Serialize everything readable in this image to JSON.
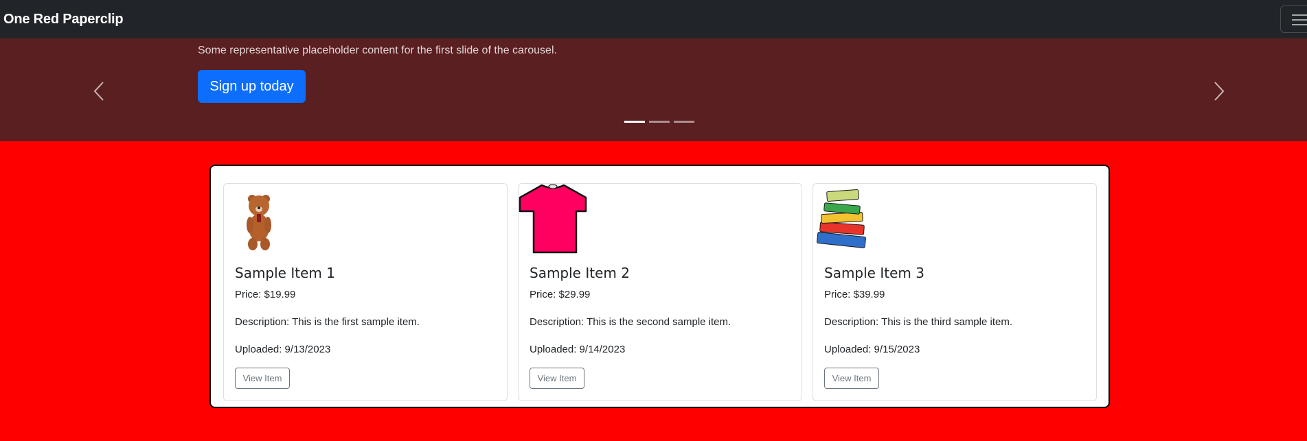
{
  "navbar": {
    "brand": "One Red Paperclip",
    "menu_icon": "hamburger-menu-icon"
  },
  "carousel": {
    "caption": "Some representative placeholder content for the first slide of the carousel.",
    "cta_label": "Sign up today",
    "prev_icon": "chevron-left-icon",
    "next_icon": "chevron-right-icon",
    "slide_count": 3,
    "active_slide": 1
  },
  "items": [
    {
      "title": "Sample Item 1",
      "price": "Price: $19.99",
      "description": "Description: This is the first sample item.",
      "uploaded": "Uploaded: 9/13/2023",
      "button": "View Item",
      "image": "teddy-bear-image"
    },
    {
      "title": "Sample Item 2",
      "price": "Price: $29.99",
      "description": "Description: This is the second sample item.",
      "uploaded": "Uploaded: 9/14/2023",
      "button": "View Item",
      "image": "tshirt-image"
    },
    {
      "title": "Sample Item 3",
      "price": "Price: $39.99",
      "description": "Description: This is the third sample item.",
      "uploaded": "Uploaded: 9/15/2023",
      "button": "View Item",
      "image": "books-stack-image"
    }
  ],
  "colors": {
    "page_bg": "#ff0000",
    "navbar_bg": "#212529",
    "carousel_bg": "#5a1f21",
    "primary": "#0d6efd",
    "tshirt": "#ff0060"
  }
}
